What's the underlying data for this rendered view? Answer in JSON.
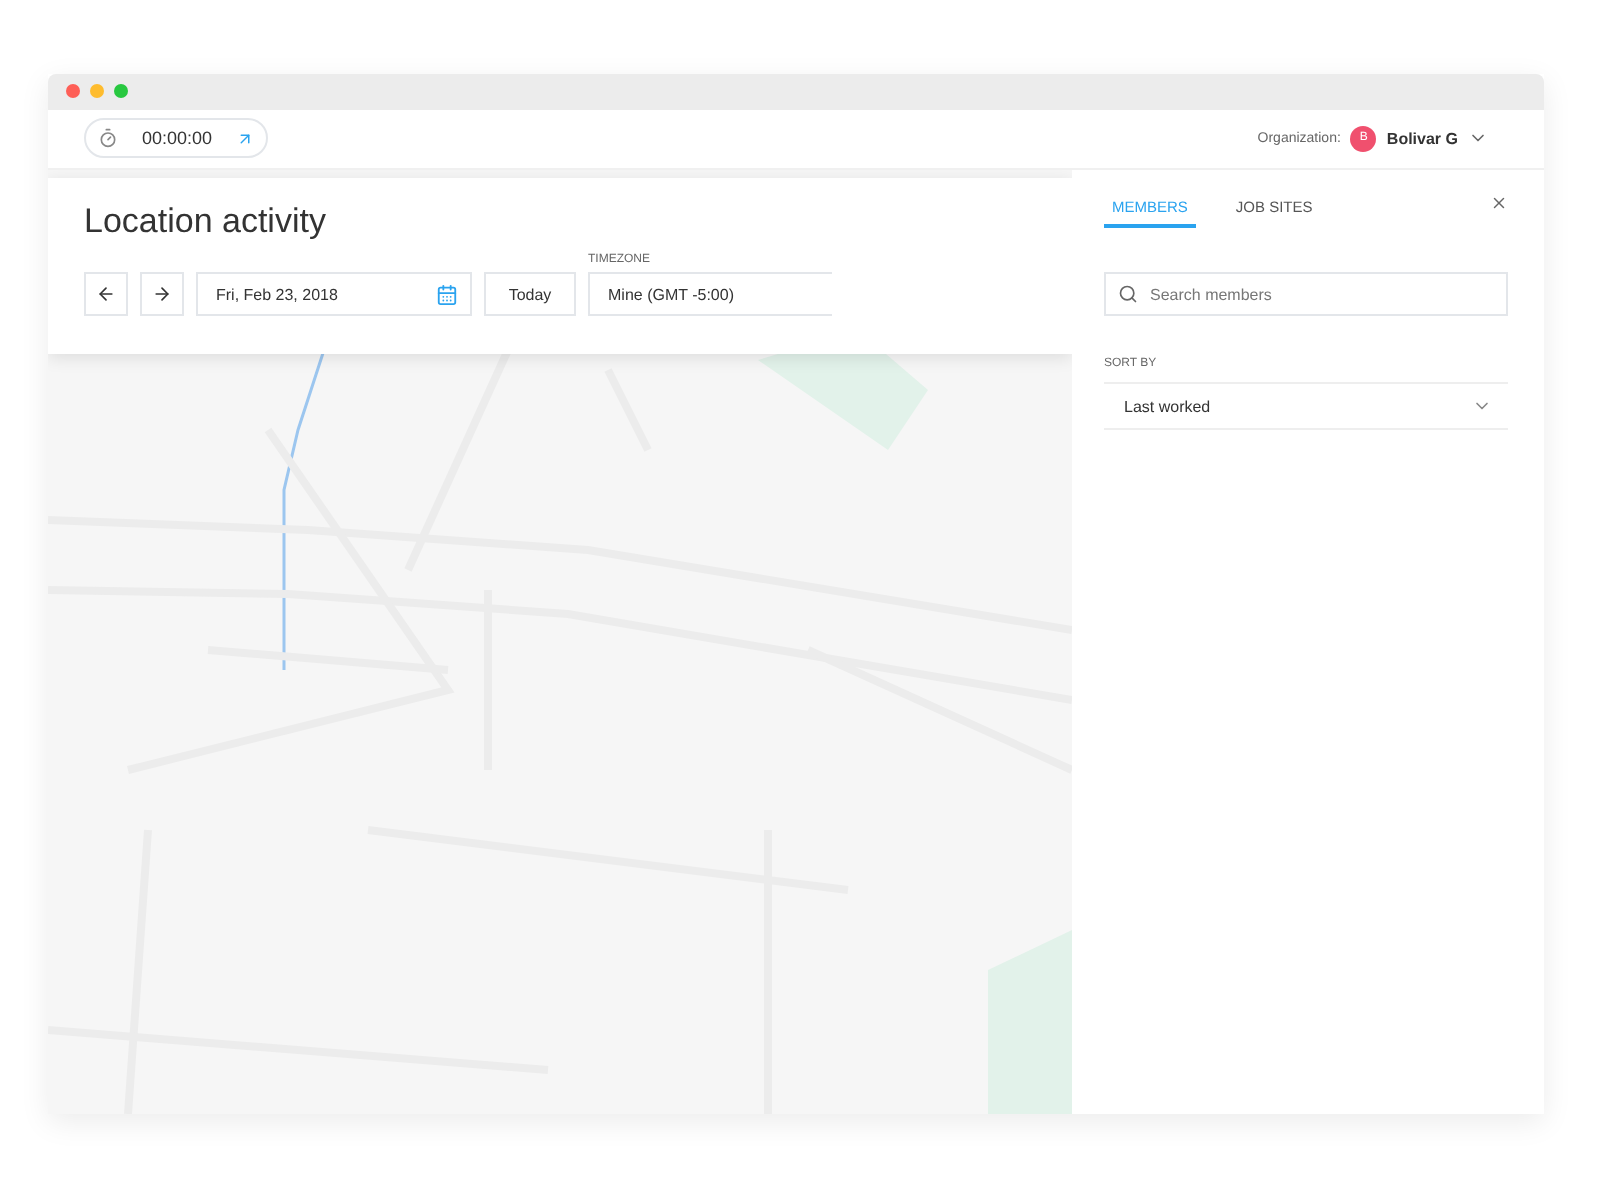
{
  "timer": {
    "time": "00:00:00"
  },
  "organization": {
    "label": "Organization:",
    "avatar_letter": "B",
    "name": "Bolivar G"
  },
  "page": {
    "title": "Location activity"
  },
  "date_picker": {
    "date": "Fri, Feb 23, 2018",
    "today_button": "Today"
  },
  "timezone": {
    "label": "TIMEZONE",
    "value": "Mine (GMT -5:00)"
  },
  "panel": {
    "tabs": [
      {
        "label": "MEMBERS",
        "selected": true
      },
      {
        "label": "JOB SITES",
        "selected": false
      }
    ],
    "search": {
      "placeholder": "Search members"
    },
    "sort": {
      "label": "SORT BY",
      "value": "Last worked"
    }
  }
}
